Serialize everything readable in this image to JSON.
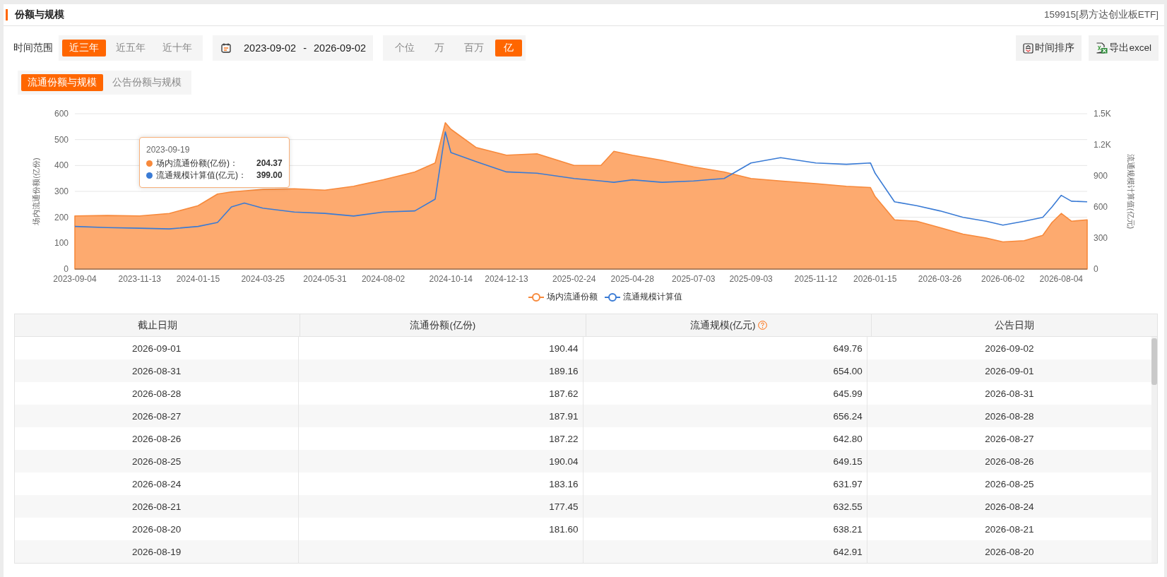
{
  "header": {
    "title": "份额与规模",
    "fund": "159915[易方达创业板ETF]"
  },
  "filters": {
    "range_label": "时间范围",
    "ranges": [
      {
        "label": "近三年",
        "selected": true
      },
      {
        "label": "近五年",
        "selected": false
      },
      {
        "label": "近十年",
        "selected": false
      }
    ],
    "date_range": {
      "start": "2023-09-02",
      "separator": "-",
      "end": "2026-09-02"
    },
    "units": [
      {
        "label": "个位",
        "selected": false
      },
      {
        "label": "万",
        "selected": false
      },
      {
        "label": "百万",
        "selected": false
      },
      {
        "label": "亿",
        "selected": true
      }
    ]
  },
  "actions": [
    {
      "kind": "sort",
      "label": "时间排序"
    },
    {
      "kind": "export",
      "label": "导出excel"
    }
  ],
  "tabs": [
    {
      "label": "流通份额与规模",
      "selected": true
    },
    {
      "label": "公告份额与规模",
      "selected": false
    }
  ],
  "chart": {
    "tooltip": {
      "date": "2023-09-19",
      "items": [
        {
          "label": "场内流通份额(亿份)：",
          "value": "204.37"
        },
        {
          "label": "流通规模计算值(亿元)：",
          "value": "399.00"
        }
      ]
    },
    "chart_data": {
      "type": "area",
      "ylabel": "场内流通份额(亿份)",
      "y2label": "流通规模计算值(亿元)",
      "x": [
        "2023-09-04",
        "2023-10-09",
        "2023-11-13",
        "2023-12-15",
        "2024-01-15",
        "2024-02-05",
        "2024-02-20",
        "2024-03-05",
        "2024-03-25",
        "2024-04-28",
        "2024-05-31",
        "2024-07-01",
        "2024-08-02",
        "2024-09-05",
        "2024-09-27",
        "2024-10-08",
        "2024-10-14",
        "2024-11-10",
        "2024-12-13",
        "2025-01-15",
        "2025-02-24",
        "2025-03-25",
        "2025-04-08",
        "2025-04-28",
        "2025-05-30",
        "2025-07-03",
        "2025-08-05",
        "2025-09-03",
        "2025-10-05",
        "2025-11-12",
        "2025-12-15",
        "2026-01-10",
        "2026-01-15",
        "2026-02-05",
        "2026-03-01",
        "2026-03-26",
        "2026-04-20",
        "2026-05-15",
        "2026-06-02",
        "2026-06-25",
        "2026-07-15",
        "2026-07-25",
        "2026-08-04",
        "2026-08-15",
        "2026-09-01"
      ],
      "series": [
        {
          "name": "场内流通份额",
          "color": "#f7893b",
          "values": [
            205,
            207,
            205,
            215,
            245,
            290,
            298,
            302,
            308,
            310,
            305,
            320,
            345,
            375,
            410,
            565,
            540,
            470,
            440,
            445,
            400,
            400,
            455,
            440,
            420,
            395,
            375,
            350,
            340,
            330,
            320,
            315,
            280,
            190,
            185,
            160,
            135,
            120,
            105,
            110,
            130,
            180,
            215,
            185,
            190
          ]
        },
        {
          "name": "流通规模计算值",
          "color": "#3a7bd5",
          "type": "line",
          "axis": "y2",
          "values": [
            412,
            400,
            395,
            388,
            412,
            450,
            600,
            638,
            588,
            550,
            538,
            512,
            550,
            562,
            675,
            1325,
            1125,
            1038,
            938,
            925,
            875,
            850,
            838,
            862,
            838,
            850,
            875,
            1025,
            1075,
            1025,
            1012,
            1025,
            925,
            650,
            612,
            562,
            500,
            462,
            425,
            462,
            500,
            600,
            712,
            655,
            650
          ]
        }
      ],
      "xticks": [
        "2023-09-04",
        "2023-11-13",
        "2024-01-15",
        "2024-03-25",
        "2024-05-31",
        "2024-08-02",
        "2024-10-14",
        "2024-12-13",
        "2025-02-24",
        "2025-04-28",
        "2025-07-03",
        "2025-09-03",
        "2025-11-12",
        "2026-01-15",
        "2026-03-26",
        "2026-06-02",
        "2026-08-04"
      ],
      "grid": true,
      "legend": "bottom",
      "xlim": [
        "2023-09-04",
        "2026-09-01"
      ],
      "ylim": [
        0,
        600
      ],
      "yticks": [
        0,
        100,
        200,
        300,
        400,
        500,
        600
      ],
      "y2lim": [
        0,
        1500
      ],
      "y2ticks": [
        0,
        300,
        600,
        900,
        {
          "value": 1200,
          "label": "1.2K"
        },
        {
          "value": 1500,
          "label": "1.5K"
        }
      ]
    }
  },
  "table": {
    "columns": [
      {
        "label": "截止日期",
        "help": false
      },
      {
        "label": "流通份额(亿份)",
        "help": false
      },
      {
        "label": "流通规模(亿元)",
        "help": true
      },
      {
        "label": "公告日期",
        "help": false
      }
    ],
    "rows": [
      [
        "2026-09-01",
        "190.44",
        "649.76",
        "2026-09-02"
      ],
      [
        "2026-08-31",
        "189.16",
        "654.00",
        "2026-09-01"
      ],
      [
        "2026-08-28",
        "187.62",
        "645.99",
        "2026-08-31"
      ],
      [
        "2026-08-27",
        "187.91",
        "656.24",
        "2026-08-28"
      ],
      [
        "2026-08-26",
        "187.22",
        "642.80",
        "2026-08-27"
      ],
      [
        "2026-08-25",
        "190.04",
        "649.15",
        "2026-08-26"
      ],
      [
        "2026-08-24",
        "183.16",
        "631.97",
        "2026-08-25"
      ],
      [
        "2026-08-21",
        "177.45",
        "632.55",
        "2026-08-24"
      ],
      [
        "2026-08-20",
        "181.60",
        "638.21",
        "2026-08-21"
      ],
      [
        "2026-08-19",
        "",
        "642.91",
        "2026-08-20"
      ]
    ]
  }
}
